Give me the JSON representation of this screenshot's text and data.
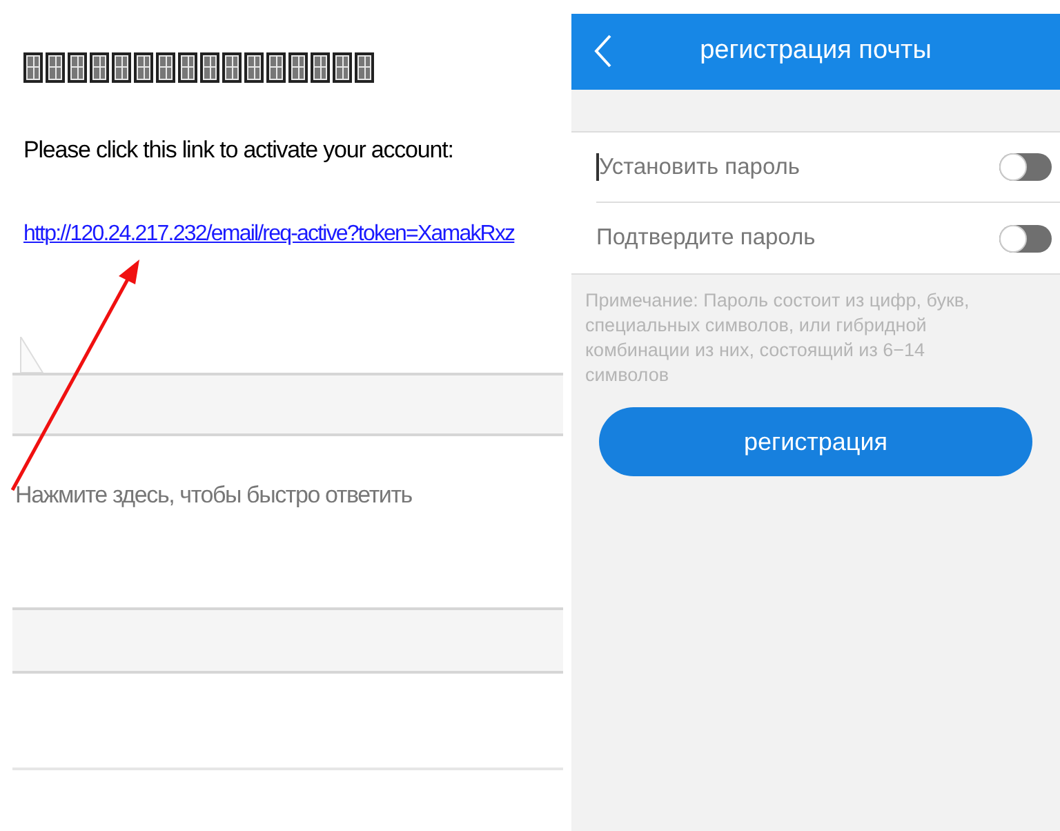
{
  "email": {
    "instruction": "Please click this link to activate your account:",
    "link": "http://120.24.217.232/email/req-active?token=XamakRxz",
    "reply_placeholder": "Нажмите здесь, чтобы быстро ответить"
  },
  "app": {
    "title": "регистрация почты",
    "fields": [
      {
        "placeholder": "Установить пароль",
        "focused": true,
        "visible": false
      },
      {
        "placeholder": "Подтвердите пароль",
        "focused": false,
        "visible": false
      }
    ],
    "note": "Примечание: Пароль состоит из цифр, букв, специальных символов, или гибридной комбинации из них, состоящий из 6−14 символов",
    "submit": "регистрация"
  }
}
